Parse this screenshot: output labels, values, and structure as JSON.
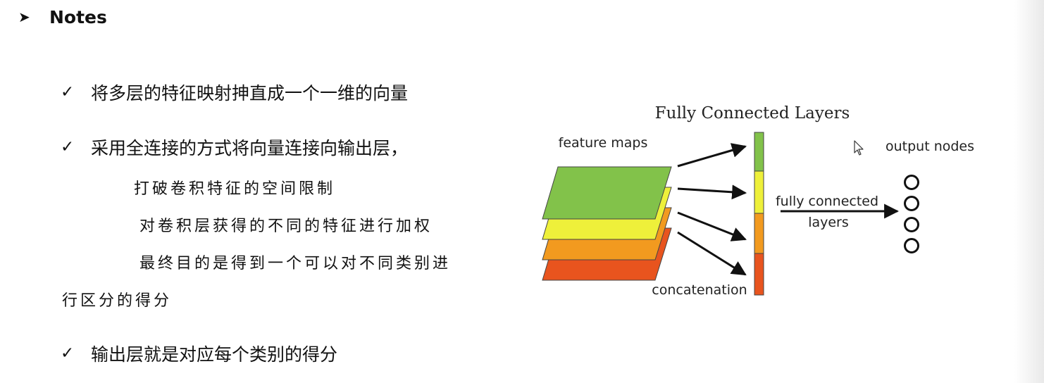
{
  "heading": {
    "marker_icon": "arrowhead-icon",
    "title": "Notes"
  },
  "bullets": [
    {
      "icon": "check-icon",
      "text": "将多层的特征映射抻直成一个一维的向量"
    },
    {
      "icon": "check-icon",
      "text": "采用全连接的方式将向量连接向输出层，"
    },
    {
      "icon": "check-icon",
      "text": "输出层就是对应每个类别的得分"
    }
  ],
  "sub_lines": [
    "打破卷积特征的空间限制",
    "对卷积层获得的不同的特征进行加权",
    "最终目的是得到一个可以对不同类别进",
    "行区分的得分"
  ],
  "diagram": {
    "title": "Fully Connected Layers",
    "feature_maps_label": "feature maps",
    "concatenation_label": "concatenation",
    "fc_label_line1": "fully connected",
    "fc_label_line2": "layers",
    "output_label": "output nodes",
    "layer_colors": [
      "#e8541e",
      "#f29a1f",
      "#eef03a",
      "#82c24a"
    ],
    "vector_colors": [
      "#82c24a",
      "#eef03a",
      "#f29a1f",
      "#e8541e"
    ],
    "output_node_count": 4
  }
}
